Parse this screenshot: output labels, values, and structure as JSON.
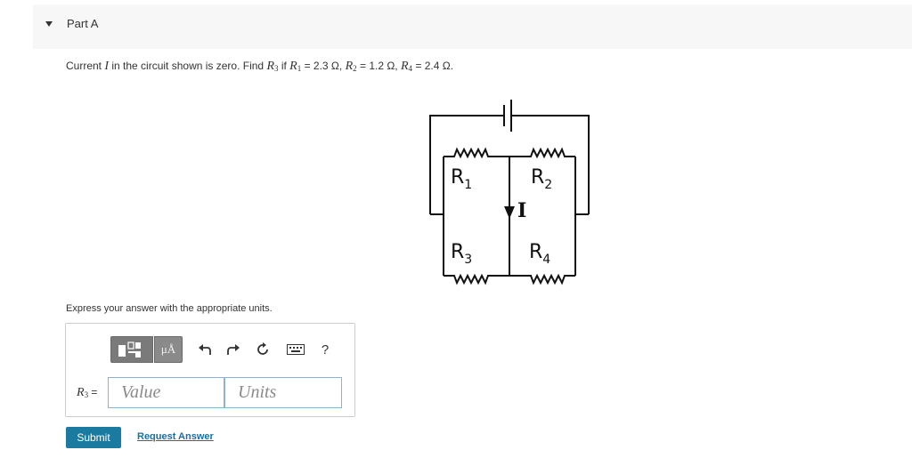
{
  "part": {
    "title": "Part A"
  },
  "question": {
    "prefix": "Current ",
    "current_symbol": "I",
    "middle": " in the circuit shown is zero. Find ",
    "target_symbol": "R",
    "target_sub": "3",
    "if_text": " if ",
    "r1_symbol": "R",
    "r1_sub": "1",
    "r1_value": " = 2.3 Ω, ",
    "r2_symbol": "R",
    "r2_sub": "2",
    "r2_value": " = 1.2 Ω, ",
    "r4_symbol": "R",
    "r4_sub": "4",
    "r4_value": " = 2.4 Ω."
  },
  "circuit": {
    "r1": {
      "letter": "R",
      "sub": "1"
    },
    "r2": {
      "letter": "R",
      "sub": "2"
    },
    "r3": {
      "letter": "R",
      "sub": "3"
    },
    "r4": {
      "letter": "R",
      "sub": "4"
    },
    "current": "I"
  },
  "instruction": "Express your answer with the appropriate units.",
  "toolbar": {
    "units_label": "μÅ",
    "undo_icon": "undo-icon",
    "redo_icon": "redo-icon",
    "reset_icon": "reset-icon",
    "keyboard_icon": "keyboard-icon",
    "help_label": "?"
  },
  "answer": {
    "label_symbol": "R",
    "label_sub": "3",
    "label_eq": " =",
    "value_placeholder": "Value",
    "units_placeholder": "Units"
  },
  "actions": {
    "submit_label": "Submit",
    "request_label": "Request Answer"
  },
  "colors": {
    "submit_bg": "#1a7a9f",
    "link": "#1a6f9f"
  }
}
